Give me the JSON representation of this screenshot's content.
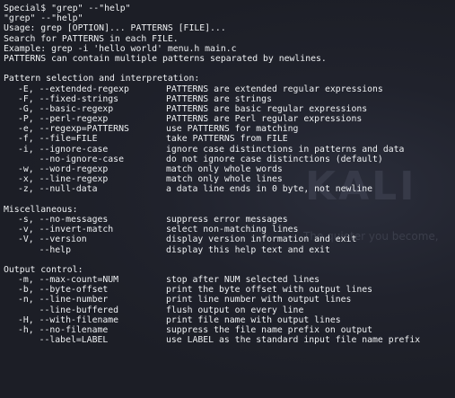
{
  "prompt": {
    "user": "Special",
    "symbol": "$",
    "command": "\"grep\" --\"help\""
  },
  "echo_line": "\"grep\" --\"help\"",
  "intro": [
    "Usage: grep [OPTION]... PATTERNS [FILE]...",
    "Search for PATTERNS in each FILE.",
    "Example: grep -i 'hello world' menu.h main.c",
    "PATTERNS can contain multiple patterns separated by newlines."
  ],
  "sections": [
    {
      "heading": "Pattern selection and interpretation:",
      "options": [
        {
          "flag": "-E, --extended-regexp",
          "desc": "PATTERNS are extended regular expressions"
        },
        {
          "flag": "-F, --fixed-strings",
          "desc": "PATTERNS are strings"
        },
        {
          "flag": "-G, --basic-regexp",
          "desc": "PATTERNS are basic regular expressions"
        },
        {
          "flag": "-P, --perl-regexp",
          "desc": "PATTERNS are Perl regular expressions"
        },
        {
          "flag": "-e, --regexp=PATTERNS",
          "desc": "use PATTERNS for matching"
        },
        {
          "flag": "-f, --file=FILE",
          "desc": "take PATTERNS from FILE"
        },
        {
          "flag": "-i, --ignore-case",
          "desc": "ignore case distinctions in patterns and data"
        },
        {
          "flag": "    --no-ignore-case",
          "desc": "do not ignore case distinctions (default)"
        },
        {
          "flag": "-w, --word-regexp",
          "desc": "match only whole words"
        },
        {
          "flag": "-x, --line-regexp",
          "desc": "match only whole lines"
        },
        {
          "flag": "-z, --null-data",
          "desc": "a data line ends in 0 byte, not newline"
        }
      ]
    },
    {
      "heading": "Miscellaneous:",
      "options": [
        {
          "flag": "-s, --no-messages",
          "desc": "suppress error messages"
        },
        {
          "flag": "-v, --invert-match",
          "desc": "select non-matching lines"
        },
        {
          "flag": "-V, --version",
          "desc": "display version information and exit"
        },
        {
          "flag": "    --help",
          "desc": "display this help text and exit"
        }
      ]
    },
    {
      "heading": "Output control:",
      "options": [
        {
          "flag": "-m, --max-count=NUM",
          "desc": "stop after NUM selected lines"
        },
        {
          "flag": "-b, --byte-offset",
          "desc": "print the byte offset with output lines"
        },
        {
          "flag": "-n, --line-number",
          "desc": "print line number with output lines"
        },
        {
          "flag": "    --line-buffered",
          "desc": "flush output on every line"
        },
        {
          "flag": "-H, --with-filename",
          "desc": "print file name with output lines"
        },
        {
          "flag": "-h, --no-filename",
          "desc": "suppress the file name prefix on output"
        },
        {
          "flag": "    --label=LABEL",
          "desc": "use LABEL as the standard input file name prefix"
        }
      ]
    }
  ],
  "watermark": {
    "logo_text": "KALI",
    "tagline": "The quieter you become,"
  },
  "colors": {
    "background": "#1c1e26",
    "text": "#eef0f2",
    "watermark": "#3a3d4c"
  }
}
